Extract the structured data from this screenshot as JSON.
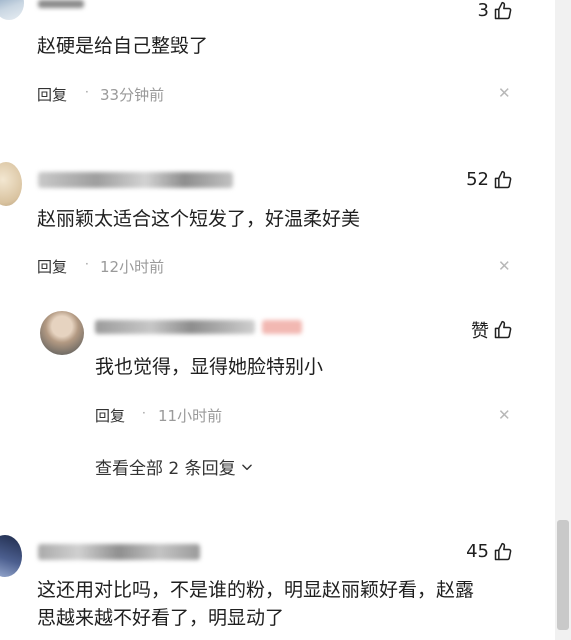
{
  "comments": [
    {
      "text": "赵硬是给自己整毁了",
      "like_count": "3",
      "reply_label": "回复",
      "time": "33分钟前"
    },
    {
      "text": "赵丽颖太适合这个短发了，好温柔好美",
      "like_count": "52",
      "reply_label": "回复",
      "time": "12小时前"
    },
    {
      "text_line1": "这还用对比吗，不是谁的粉，明显赵丽颖好看，赵露",
      "text_line2": "思越来越不好看了，明显动了",
      "like_count": "45"
    }
  ],
  "reply": {
    "text": "我也觉得，显得她脸特别小",
    "like_label": "赞",
    "reply_label": "回复",
    "time": "11小时前"
  },
  "expand_replies_label": "查看全部 2 条回复",
  "icons": {
    "like": "thumbs-up-icon",
    "close": "close-icon",
    "expand": "chevron-down-icon"
  },
  "colors": {
    "text": "#1f1f1f",
    "meta": "#9a9a9a",
    "scrollbar_thumb": "#c9c9c9"
  }
}
